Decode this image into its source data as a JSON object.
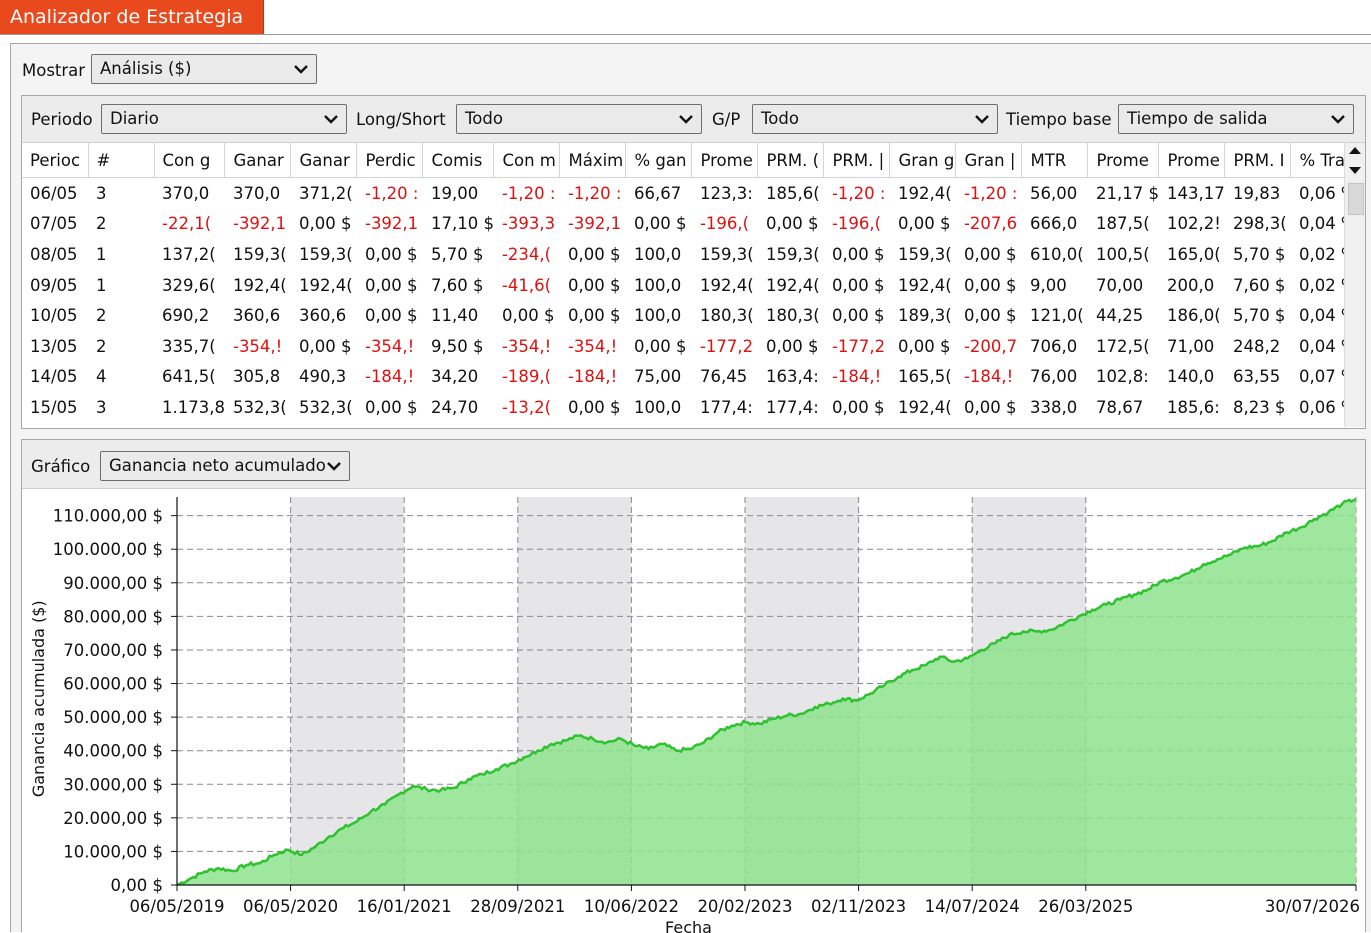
{
  "app": {
    "title": "Analizador de Estrategia"
  },
  "top": {
    "show_label": "Mostrar",
    "show_value": "Análisis ($)"
  },
  "filters": {
    "period_label": "Periodo",
    "period_value": "Diario",
    "ls_label": "Long/Short",
    "ls_value": "Todo",
    "gp_label": "G/P",
    "gp_value": "Todo",
    "tb_label": "Tiempo base",
    "tb_value": "Tiempo de salida"
  },
  "table": {
    "columns": [
      "Perioc",
      "#",
      "Con g",
      "Ganar",
      "Ganar",
      "Perdic",
      "Comis",
      "Con m",
      "Máxim",
      "% gan",
      "Prome",
      "PRM. (",
      "PRM. |",
      "Gran g",
      "Gran |",
      "MTR",
      "Prome",
      "Prome",
      "PRM. I",
      "% Trac"
    ],
    "rows": [
      [
        "06/05",
        "3",
        "370,0",
        "370,0",
        "371,2(",
        "-1,20 :",
        "19,00",
        "-1,20 :",
        "-1,20 :",
        "66,67",
        "123,3:",
        "185,6(",
        "-1,20 :",
        "192,4(",
        "-1,20 :",
        "56,00",
        "21,17 $",
        "143,17",
        "19,83",
        "0,06 %"
      ],
      [
        "07/05",
        "2",
        "-22,1(",
        "-392,1",
        "0,00 $",
        "-392,1",
        "17,10 $",
        "-393,3",
        "-392,1",
        "0,00 $",
        "-196,(",
        "0,00 $",
        "-196,(",
        "0,00 $",
        "-207,6",
        "666,0",
        "187,5(",
        "102,2!",
        "298,3(",
        "0,04 %"
      ],
      [
        "08/05",
        "1",
        "137,2(",
        "159,3(",
        "159,3(",
        "0,00 $",
        "5,70 $",
        "-234,(",
        "0,00 $",
        "100,0",
        "159,3(",
        "159,3(",
        "0,00 $",
        "159,3(",
        "0,00 $",
        "610,0(",
        "100,5(",
        "165,0(",
        "5,70 $",
        "0,02 %"
      ],
      [
        "09/05",
        "1",
        "329,6(",
        "192,4(",
        "192,4(",
        "0,00 $",
        "7,60 $",
        "-41,6(",
        "0,00 $",
        "100,0",
        "192,4(",
        "192,4(",
        "0,00 $",
        "192,4(",
        "0,00 $",
        "9,00",
        "70,00",
        "200,0",
        "7,60 $",
        "0,02 %"
      ],
      [
        "10/05",
        "2",
        "690,2",
        "360,6",
        "360,6",
        "0,00 $",
        "11,40",
        "0,00 $",
        "0,00 $",
        "100,0",
        "180,3(",
        "180,3(",
        "0,00 $",
        "189,3(",
        "0,00 $",
        "121,0(",
        "44,25",
        "186,0(",
        "5,70 $",
        "0,04 %"
      ],
      [
        "13/05",
        "2",
        "335,7(",
        "-354,!",
        "0,00 $",
        "-354,!",
        "9,50 $",
        "-354,!",
        "-354,!",
        "0,00 $",
        "-177,2",
        "0,00 $",
        "-177,2",
        "0,00 $",
        "-200,7",
        "706,0",
        "172,5(",
        "71,00",
        "248,2",
        "0,04 %"
      ],
      [
        "14/05",
        "4",
        "641,5(",
        "305,8",
        "490,3",
        "-184,!",
        "34,20",
        "-189,(",
        "-184,!",
        "75,00",
        "76,45",
        "163,4:",
        "-184,!",
        "165,5(",
        "-184,!",
        "76,00",
        "102,8:",
        "140,0",
        "63,55",
        "0,07 %"
      ],
      [
        "15/05",
        "3",
        "1.173,8",
        "532,3(",
        "532,3(",
        "0,00 $",
        "24,70",
        "-13,2(",
        "0,00 $",
        "100,0",
        "177,4:",
        "177,4:",
        "0,00 $",
        "192,4(",
        "0,00 $",
        "338,0",
        "78,67",
        "185,6:",
        "8,23 $",
        "0,06 %"
      ]
    ]
  },
  "graph": {
    "label": "Gráfico",
    "value": "Ganancia neto acumulado"
  },
  "chart_data": {
    "type": "area",
    "ylabel": "Ganancia acumulada ($)",
    "xlabel": "Fecha",
    "x_ticks": [
      "06/05/2019",
      "06/05/2020",
      "16/01/2021",
      "28/09/2021",
      "10/06/2022",
      "20/02/2023",
      "02/11/2023",
      "14/07/2024",
      "26/03/2025",
      "30/07/2026"
    ],
    "y_ticks": [
      "110.000,00 $",
      "100.000,00 $",
      "90.000,00 $",
      "80.000,00 $",
      "70.000,00 $",
      "60.000,00 $",
      "50.000,00 $",
      "40.000,00 $",
      "30.000,00 $",
      "20.000,00 $",
      "10.000,00 $",
      "0,00 $"
    ],
    "ylim": [
      0,
      115000
    ],
    "series": [
      {
        "values": [
          0,
          2000,
          4000,
          5000,
          4200,
          6000,
          6500,
          9000,
          10500,
          9000,
          11500,
          14500,
          17000,
          19000,
          22000,
          24000,
          27000,
          29500,
          28500,
          28200,
          29000,
          31500,
          33000,
          34500,
          36000,
          38000,
          40000,
          42000,
          43000,
          44500,
          43500,
          42500,
          43500,
          41500,
          40500,
          42000,
          40000,
          40500,
          42500,
          45500,
          47500,
          48500,
          48000,
          49500,
          50500,
          51000,
          53000,
          54000,
          55500,
          55000,
          57000,
          59500,
          62000,
          64000,
          65500,
          68000,
          66500,
          67500,
          70000,
          72000,
          74500,
          75500,
          75500,
          76000,
          78000,
          80000,
          82000,
          83500,
          85000,
          86500,
          88000,
          90500,
          91500,
          93000,
          95500,
          97000,
          98500,
          100500,
          101000,
          102500,
          105000,
          106500,
          109000,
          111000,
          113500,
          115000
        ]
      }
    ],
    "fill_color": "#8ee28e",
    "line_color": "#2ec22e",
    "band_color": "#e6e6e8",
    "grid": true
  }
}
